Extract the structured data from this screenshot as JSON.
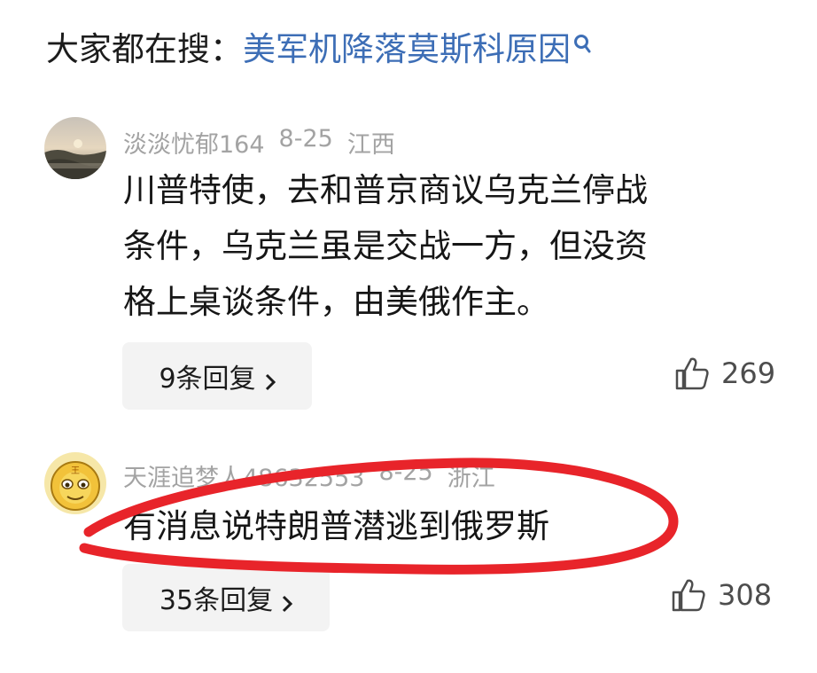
{
  "search": {
    "prefix": "大家都在搜：",
    "query": "美军机降落莫斯科原因",
    "icon": "search-icon"
  },
  "comments": [
    {
      "username": "淡淡忧郁164",
      "date": "8-25",
      "location": "江西",
      "lines": [
        "川普特使，去和普京商议乌克兰停战",
        "条件，乌克兰虽是交战一方，但没资",
        "格上桌谈条件，由美俄作主。"
      ],
      "replies_label": "9条回复",
      "likes": "269",
      "avatar": "sunset-landscape-avatar"
    },
    {
      "username": "天涯追梦人48632553",
      "date": "8-25",
      "location": "浙江",
      "lines": [
        "有消息说特朗普潜逃到俄罗斯"
      ],
      "replies_label": "35条回复",
      "likes": "308",
      "avatar": "cartoon-lion-avatar"
    }
  ],
  "annotation": {
    "color": "#e8242a",
    "shape": "hand-drawn-ellipse"
  }
}
